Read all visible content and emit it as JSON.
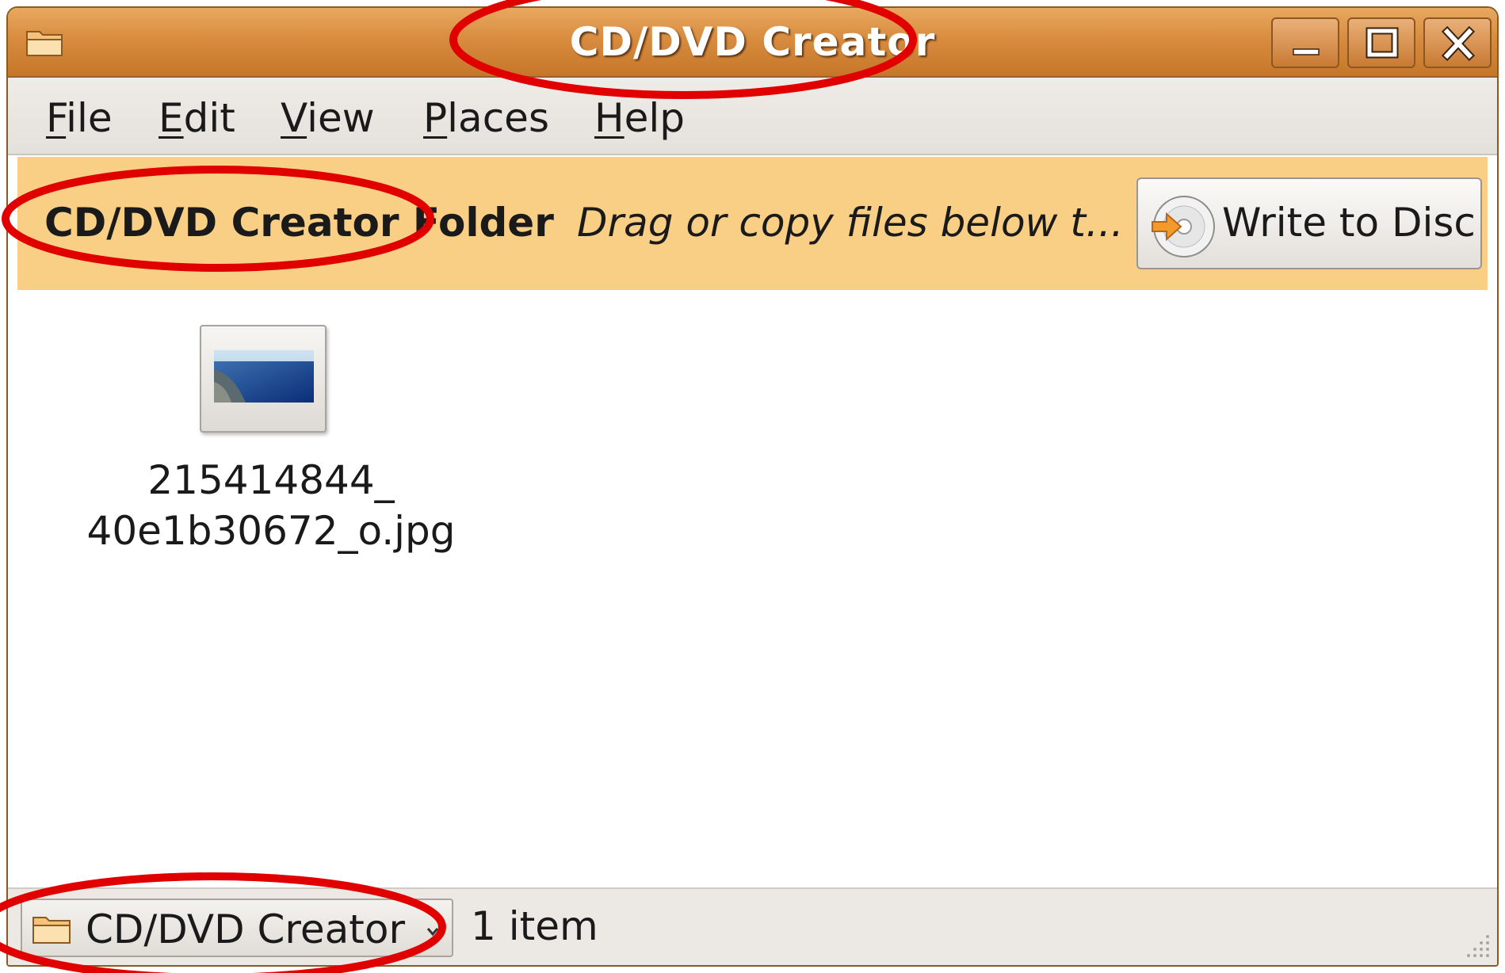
{
  "window": {
    "title": "CD/DVD Creator"
  },
  "menu": {
    "items": [
      {
        "label": "File",
        "mnemonic": "F",
        "rest": "ile"
      },
      {
        "label": "Edit",
        "mnemonic": "E",
        "rest": "dit"
      },
      {
        "label": "View",
        "mnemonic": "V",
        "rest": "iew"
      },
      {
        "label": "Places",
        "mnemonic": "P",
        "rest": "laces"
      },
      {
        "label": "Help",
        "mnemonic": "H",
        "rest": "elp"
      }
    ]
  },
  "infobar": {
    "title": "CD/DVD Creator Folder",
    "description": "Drag or copy files below t...",
    "write_button_label": "Write to Disc"
  },
  "files": [
    {
      "name_line1": "215414844_",
      "name_line2": "40e1b30672_o.jpg",
      "icon": "image-thumbnail-icon"
    }
  ],
  "statusbar": {
    "location_label": "CD/DVD Creator",
    "item_count": "1 item"
  },
  "colors": {
    "titlebar": "#d88c3f",
    "infobar": "#f9cf85",
    "annotation": "#e00000"
  }
}
